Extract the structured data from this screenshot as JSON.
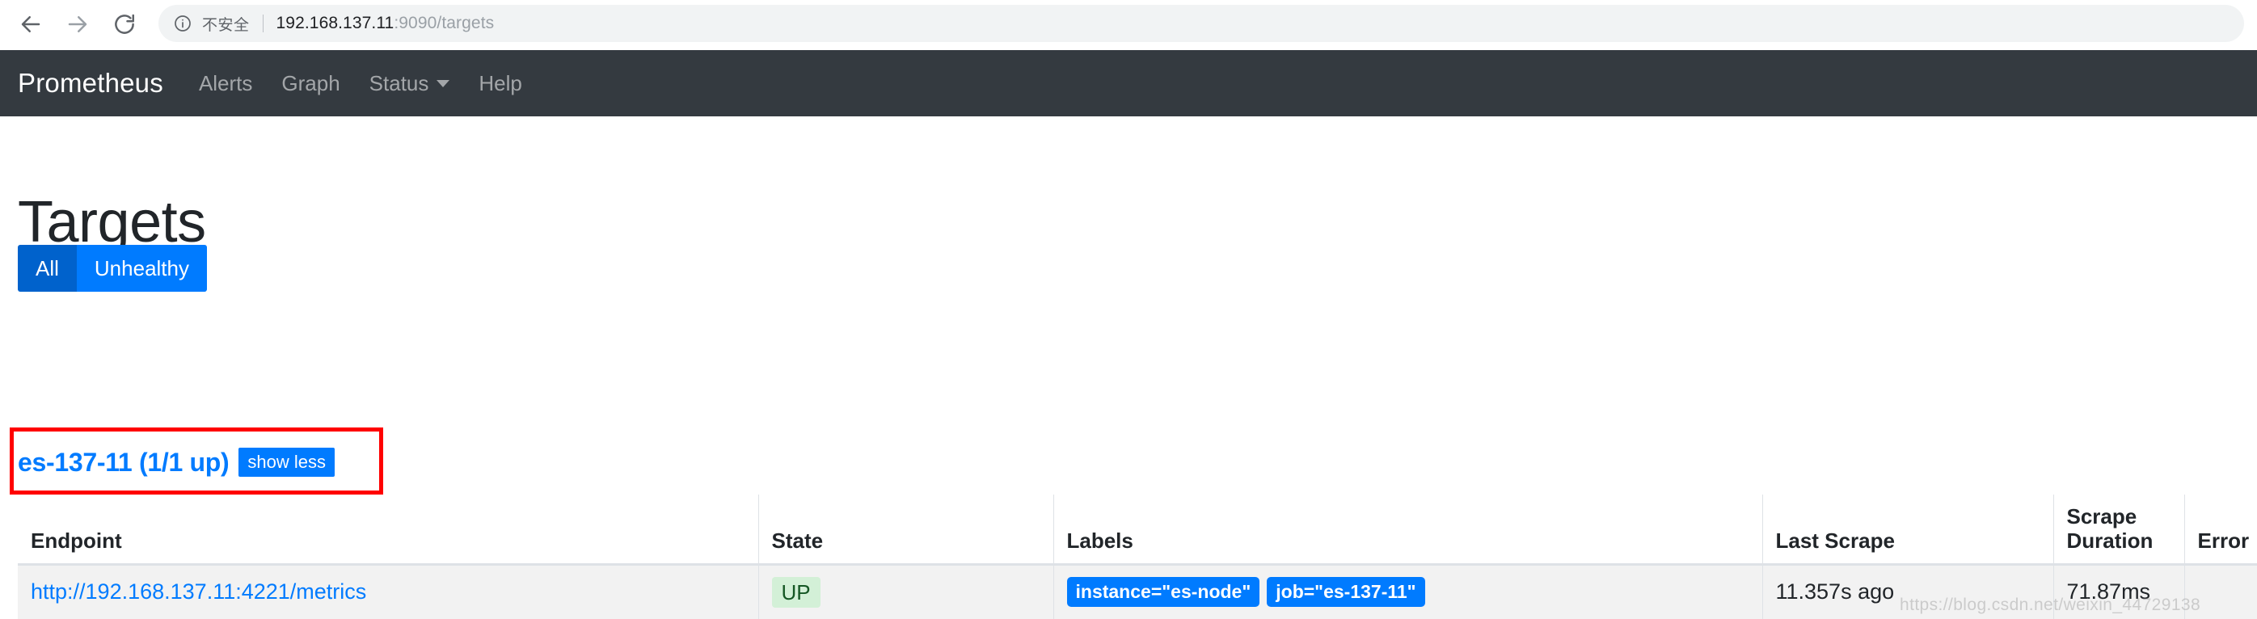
{
  "browser": {
    "back_icon": "arrow-left-icon",
    "forward_icon": "arrow-right-icon",
    "reload_icon": "reload-icon",
    "info_icon": "info-circle-icon",
    "security_label": "不安全",
    "url_host": "192.168.137.11",
    "url_rest": ":9090/targets",
    "url_full": "192.168.137.11:9090/targets"
  },
  "navbar": {
    "brand": "Prometheus",
    "links": [
      {
        "label": "Alerts",
        "has_caret": false
      },
      {
        "label": "Graph",
        "has_caret": false
      },
      {
        "label": "Status",
        "has_caret": true
      },
      {
        "label": "Help",
        "has_caret": false
      }
    ]
  },
  "page": {
    "title": "Targets"
  },
  "filters": {
    "all_label": "All",
    "unhealthy_label": "Unhealthy",
    "active": "All"
  },
  "job": {
    "title": "es-137-11 (1/1 up)",
    "toggle_label": "show less"
  },
  "table": {
    "headers": {
      "endpoint": "Endpoint",
      "state": "State",
      "labels": "Labels",
      "last_scrape": "Last Scrape",
      "scrape_duration": "Scrape Duration",
      "error": "Error"
    },
    "rows": [
      {
        "endpoint": "http://192.168.137.11:4221/metrics",
        "state": "UP",
        "labels": [
          "instance=\"es-node\"",
          "job=\"es-137-11\""
        ],
        "last_scrape": "11.357s ago",
        "scrape_duration": "71.87ms",
        "error": ""
      }
    ]
  },
  "watermark": "https://blog.csdn.net/weixin_44729138",
  "colors": {
    "navbar_bg": "#343a40",
    "primary_blue": "#007bff",
    "active_blue": "#0062cc",
    "state_up_bg": "#d3f0d7",
    "state_up_text": "#155724",
    "annotation_red": "#ff0000"
  }
}
